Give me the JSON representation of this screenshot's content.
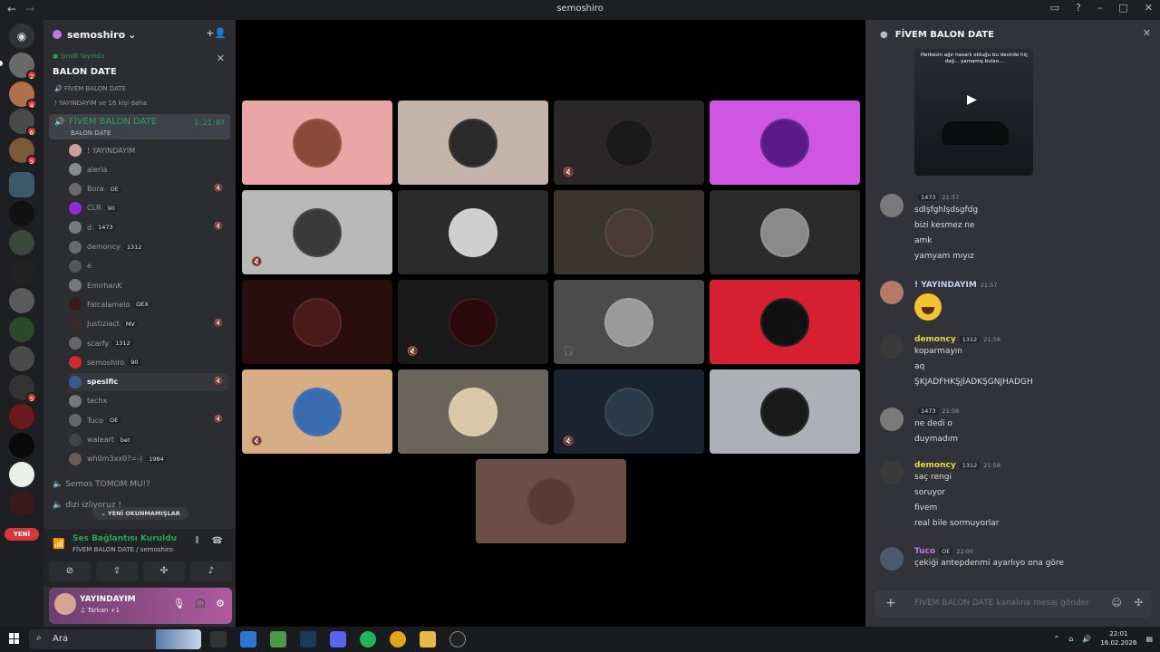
{
  "titlebar": {
    "title": "semoshiro"
  },
  "guilds": {
    "badges": [
      "2",
      "4",
      "6",
      "5",
      "5"
    ],
    "new_label": "YENİ"
  },
  "server": {
    "name": "semoshiro",
    "live_label": "Şimdi Yayında",
    "stage_title": "BALON DATE",
    "stage_channel": "FİVEM BALON DATE",
    "stage_listeners": "! YAYINDAYIM ve 16 kişi daha",
    "voice_channel": {
      "name": "FİVEM BALON DATE",
      "topic": "BALON DATE",
      "timer": "1:21:07"
    },
    "members": [
      {
        "name": "! YAYINDAYIM",
        "tag": "",
        "color": "#c9a0a0"
      },
      {
        "name": "aleria",
        "tag": "",
        "color": "#8a8a8a"
      },
      {
        "name": "Bora",
        "tag": "OE",
        "color": "#6a6a6a"
      },
      {
        "name": "CLR",
        "tag": "90",
        "color": "#8e2bd6"
      },
      {
        "name": "d",
        "tag": "1473",
        "color": "#7a7a7a"
      },
      {
        "name": "demoncy",
        "tag": "1312",
        "color": "#6a6a6a"
      },
      {
        "name": "e",
        "tag": "",
        "color": "#555"
      },
      {
        "name": "EmirhanK",
        "tag": "",
        "color": "#777"
      },
      {
        "name": "Falcalamelo",
        "tag": "ΩEX",
        "color": "#3a1a1a"
      },
      {
        "name": "Justiziact",
        "tag": "MV",
        "color": "#3a2a2a"
      },
      {
        "name": "scarfy",
        "tag": "1312",
        "color": "#666"
      },
      {
        "name": "semoshiro",
        "tag": "90",
        "color": "#d12a2a"
      },
      {
        "name": "spesific",
        "tag": "",
        "color": "#3a5a8a"
      },
      {
        "name": "techx",
        "tag": "",
        "color": "#777"
      },
      {
        "name": "Tuco",
        "tag": "OE",
        "color": "#666"
      },
      {
        "name": "waleart",
        "tag": "bet",
        "color": "#444"
      },
      {
        "name": "wh0m3xx0?=-)",
        "tag": "1984",
        "color": "#6a5a5a"
      }
    ],
    "channels": [
      "Semos TOMOM MU!?",
      "dizi izliyoruz !"
    ],
    "unread_label": "YENİ OKUNMAMIŞLAR"
  },
  "voice_panel": {
    "status": "Ses Bağlantısı Kuruldu",
    "path": "FİVEM BALON DATE / semoshiro"
  },
  "user_panel": {
    "name": "YAYINDAYIM",
    "status": "Tarkan +1"
  },
  "chat": {
    "title": "FİVEM BALON DATE",
    "video_caption": "Herkesin ağır hasarlı olduğu bu devirde hiç dağ... yamamış bulan...",
    "messages": [
      {
        "author": "",
        "badge": "1473",
        "time": "21:57",
        "lines": [
          "sdlşfghlşdsgfdg",
          "bizi kesmez ne",
          "amk",
          "yamyam mıyız"
        ],
        "color": "#dbdee1"
      },
      {
        "author": "! YAYINDAYIM",
        "badge": "",
        "time": "21:57",
        "lines": [],
        "color": "#c9cdf5"
      },
      {
        "author": "demoncy",
        "badge": "1312",
        "time": "21:58",
        "lines": [
          "koparmayın",
          "aq",
          "ŞKJADFHKŞJİADKŞGNJHADGH"
        ],
        "color": "#e6d84a"
      },
      {
        "author": "",
        "badge": "1473",
        "time": "21:58",
        "lines": [
          "ne dedi o",
          "duymadım"
        ],
        "color": "#dbdee1"
      },
      {
        "author": "demoncy",
        "badge": "1312",
        "time": "21:58",
        "lines": [
          "saç rengi",
          "soruyor",
          "fivem",
          "real bile sormuyorlar"
        ],
        "color": "#e6d84a"
      },
      {
        "author": "Tuco",
        "badge": "OE",
        "time": "22:00",
        "lines": [
          "çekiği antepdenmi ayarlıyo ona göre"
        ],
        "color": "#c178e6"
      }
    ],
    "composer_placeholder": "FİVEM BALON DATE kanalına mesaj gönder"
  },
  "taskbar": {
    "search_label": "Ara",
    "time": "22:01",
    "date": "16.02.2026"
  },
  "colors": {
    "accent": "#23a55a",
    "danger": "#da373c"
  }
}
